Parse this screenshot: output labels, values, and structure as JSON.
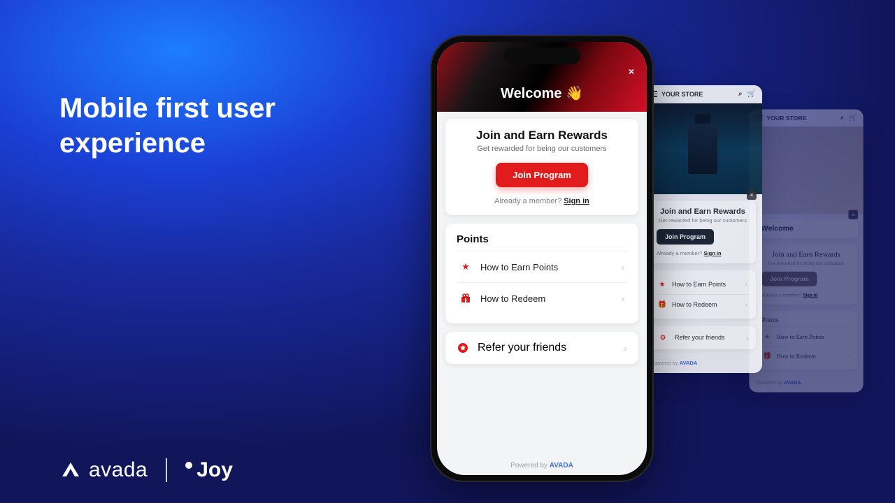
{
  "headline": "Mobile first user experience",
  "logos": {
    "avada": "avada",
    "joy": "Joy"
  },
  "phone": {
    "welcome": "Welcome 👋",
    "close": "×",
    "join_card": {
      "title": "Join and Earn Rewards",
      "sub": "Get rewarded for being our customers",
      "button": "Join Program",
      "already_prefix": "Already a member? ",
      "sign_in": "Sign in"
    },
    "points": {
      "title": "Points",
      "rows": [
        {
          "icon": "star-icon",
          "label": "How to Earn Points"
        },
        {
          "icon": "gift-icon",
          "label": "How to Redeem"
        }
      ]
    },
    "refer": {
      "icon": "badge-icon",
      "label": "Refer your friends"
    },
    "powered_prefix": "Powered by ",
    "powered_brand": "AVADA"
  },
  "mini_mid": {
    "store": "YOUR STORE",
    "close": "×",
    "join_title": "Join and Earn Rewards",
    "join_sub": "Get rewarded for being our customers",
    "join_btn": "Join Program",
    "already_prefix": "Already a member? ",
    "sign_in": "Sign in",
    "rows": [
      {
        "label": "How to Earn Points"
      },
      {
        "label": "How to Redeem"
      }
    ],
    "refer": "Refer your friends",
    "powered_prefix": "Powered by ",
    "powered_brand": "AVADA"
  },
  "mini_far": {
    "store": "YOUR STORE",
    "close": "×",
    "welcome": "Welcome",
    "join_title": "Join and Earn Rewards",
    "join_sub": "Get rewarded for being our customers",
    "join_btn": "Join Program",
    "already_prefix": "Already a member? ",
    "sign_in": "Sign in",
    "points_title": "Points",
    "rows": [
      {
        "label": "How to Earn Points"
      },
      {
        "label": "How to Redeem"
      }
    ],
    "powered_prefix": "Powered by ",
    "powered_brand": "AVADA"
  }
}
